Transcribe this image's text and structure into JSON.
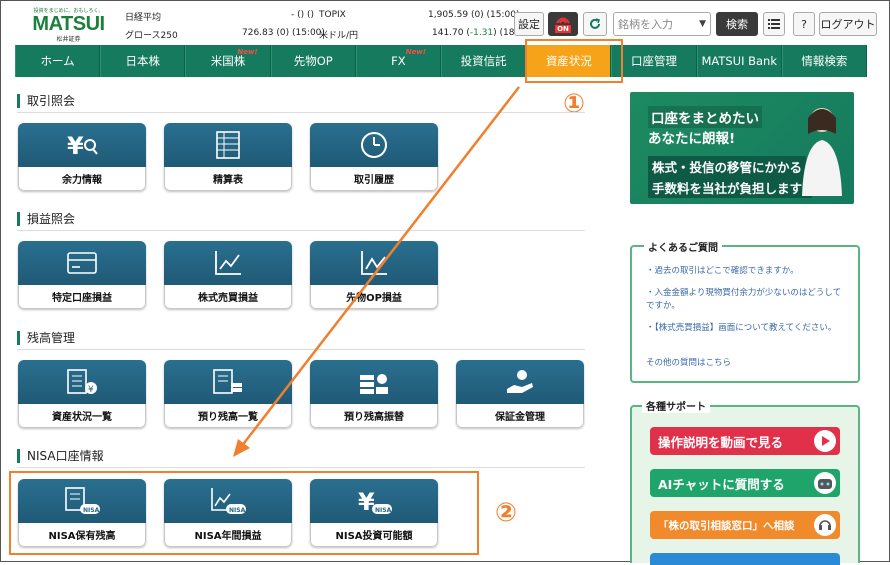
{
  "logo": {
    "tagline": "投資をまじめに、おもしろく。",
    "name": "MATSUI",
    "sub": "松井証券"
  },
  "market": [
    {
      "name": "日経平均",
      "value": "- () ()",
      "name2": "TOPIX",
      "value2": "1,905.59 (0) (15:00)"
    },
    {
      "name": "グロース250",
      "value": "726.83 (0) (15:00)",
      "name2": "米ドル/円",
      "value2a": "141.70 (",
      "change": "-1.31",
      "value2b": ") (18:36)"
    }
  ],
  "toolbar": {
    "settings": "設定",
    "on_label": "ON",
    "search_placeholder": "銘柄を入力",
    "search": "検索",
    "help": "?",
    "logout": "ログアウト"
  },
  "nav": [
    {
      "label": "ホーム",
      "new": ""
    },
    {
      "label": "日本株",
      "new": ""
    },
    {
      "label": "米国株",
      "new": "New!"
    },
    {
      "label": "先物OP",
      "new": ""
    },
    {
      "label": "FX",
      "new": "New!"
    },
    {
      "label": "投資信託",
      "new": ""
    },
    {
      "label": "資産状況",
      "new": ""
    },
    {
      "label": "口座管理",
      "new": ""
    },
    {
      "label": "MATSUI Bank",
      "new": ""
    },
    {
      "label": "情報検索",
      "new": ""
    }
  ],
  "sections": {
    "trade": "取引照会",
    "pnl": "損益照会",
    "balance": "残高管理",
    "nisa": "NISA口座情報"
  },
  "tiles": {
    "trade": [
      "余力情報",
      "精算表",
      "取引履歴"
    ],
    "pnl": [
      "特定口座損益",
      "株式売買損益",
      "先物OP損益"
    ],
    "balance": [
      "資産状況一覧",
      "預り残高一覧",
      "預り残高振替",
      "保証金管理"
    ],
    "nisa": [
      "NISA保有残高",
      "NISA年間損益",
      "NISA投資可能額"
    ]
  },
  "banner": {
    "l1": "口座をまとめたい",
    "l2": "あなたに朗報!",
    "l3": "株式・投信の移管にかかる",
    "l4": "手数料を当社が負担します!"
  },
  "faq": {
    "title": "よくあるご質問",
    "q1": "・過去の取引はどこで確認できますか。",
    "q2": "・入金金額より現物買付余力が少ないのはどうしてですか。",
    "q3": "・【株式売買損益】画面について教えてください。",
    "more": "その他の質問はこちら"
  },
  "support": {
    "title": "各種サポート",
    "b1": "操作説明を動画で見る",
    "b2": "AIチャットに質問する",
    "b3": "「株の取引相談窓口」へ相談"
  },
  "annotations": {
    "one": "①",
    "two": "②"
  },
  "colors": {
    "nav": "#157a5e",
    "active": "#f6a31a",
    "annotation": "#f07f2e",
    "tile": "#246582"
  }
}
